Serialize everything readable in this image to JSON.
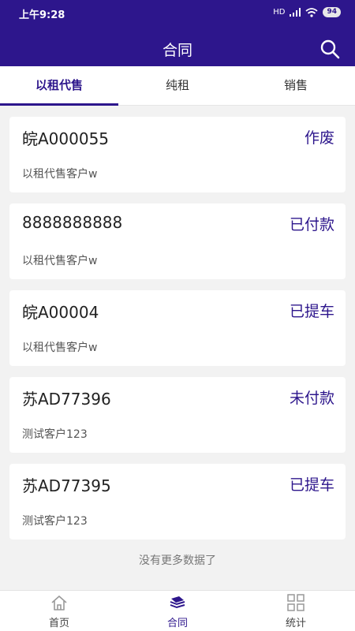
{
  "status_bar": {
    "time": "上午9:28",
    "signal_label": "HD",
    "battery": "94"
  },
  "header": {
    "title": "合同"
  },
  "tabs": [
    {
      "label": "以租代售",
      "active": true
    },
    {
      "label": "纯租",
      "active": false
    },
    {
      "label": "销售",
      "active": false
    }
  ],
  "contracts": [
    {
      "number": "皖A000055",
      "status": "作废",
      "customer": "以租代售客户w"
    },
    {
      "number": "8888888888",
      "status": "已付款",
      "customer": "以租代售客户w"
    },
    {
      "number": "皖A00004",
      "status": "已提车",
      "customer": "以租代售客户w"
    },
    {
      "number": "苏AD77396",
      "status": "未付款",
      "customer": "测试客户123"
    },
    {
      "number": "苏AD77395",
      "status": "已提车",
      "customer": "测试客户123"
    }
  ],
  "list_footer": "没有更多数据了",
  "bottom_nav": [
    {
      "label": "首页",
      "icon": "home-icon",
      "active": false
    },
    {
      "label": "合同",
      "icon": "contract-icon",
      "active": true
    },
    {
      "label": "统计",
      "icon": "stats-grid-icon",
      "active": false
    }
  ],
  "colors": {
    "primary": "#2d168c",
    "background": "#f2f2f2"
  }
}
